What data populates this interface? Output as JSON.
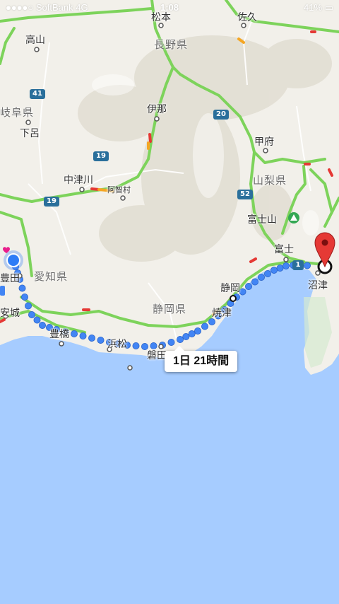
{
  "status_bar": {
    "carrier": "SoftBank",
    "network": "4G",
    "time": "1:08",
    "battery_percent": "41%"
  },
  "prefectures": {
    "gifu": "岐阜県",
    "nagano": "長野県",
    "yamanashi": "山梨県",
    "aichi": "愛知県",
    "shizuoka": "静岡県"
  },
  "cities": {
    "matsumoto": "松本",
    "saku": "佐久",
    "takayama": "高山",
    "ina": "伊那",
    "gero": "下呂",
    "kofu": "甲府",
    "nakatsugawa": "中津川",
    "achi": "阿智村",
    "fujisan": "富士山",
    "toyota": "豊田",
    "anjo": "安城",
    "fuji": "富士",
    "numazu": "沼津",
    "shizuoka": "静岡",
    "yaizu": "焼津",
    "toyohashi": "豊橋",
    "hamamatsu": "浜松",
    "iwata": "磐田"
  },
  "route_shields": {
    "r41": "41",
    "r19a": "19",
    "r19b": "19",
    "r20": "20",
    "r52": "52",
    "r1": "1"
  },
  "route_info": {
    "duration": "1日 21時間"
  },
  "colors": {
    "water": "#a6ccff",
    "land": "#f1efe9",
    "route": "#4285f4",
    "highway": "#7dd35b",
    "origin": "#2e7cf6",
    "destination": "#e53935"
  }
}
